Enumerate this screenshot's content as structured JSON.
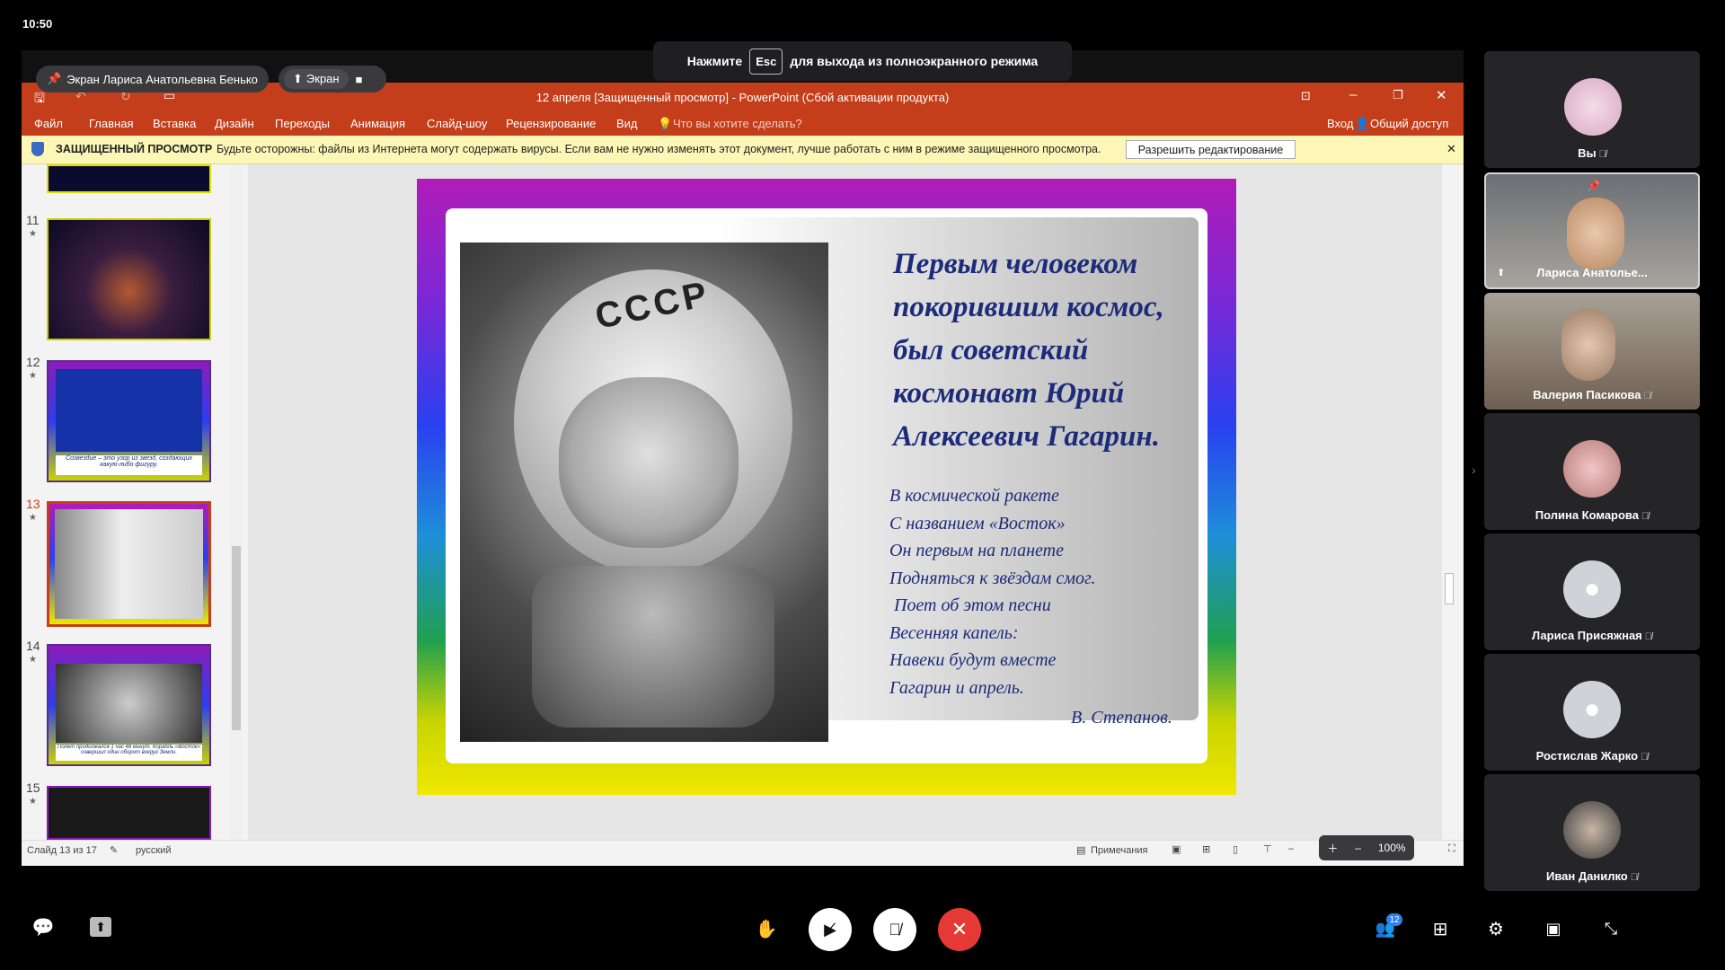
{
  "status": {
    "clock": "10:50"
  },
  "banner": {
    "before": "Нажмите",
    "key": "Esc",
    "after": "для выхода из полноэкранного режима"
  },
  "share": {
    "pinned_label": "Экран Лариса Анатольевна Бенько",
    "screen_label": "Экран"
  },
  "ppt": {
    "title": "12 апреля [Защищенный просмотр] - PowerPoint (Сбой активации продукта)",
    "tabs": [
      "Файл",
      "Главная",
      "Вставка",
      "Дизайн",
      "Переходы",
      "Анимация",
      "Слайд-шоу",
      "Рецензирование",
      "Вид"
    ],
    "tell_me": "Что вы хотите сделать?",
    "signin": "Вход",
    "share": "Общий доступ",
    "protected": {
      "label": "ЗАЩИЩЕННЫЙ ПРОСМОТР",
      "message": "Будьте осторожны: файлы из Интернета могут содержать вирусы. Если вам не нужно изменять этот документ, лучше работать с ним в режиме защищенного просмотра.",
      "button": "Разрешить редактирование"
    },
    "thumbnails": [
      {
        "num": "11",
        "caption": ""
      },
      {
        "num": "12",
        "caption": "Созвездие – это узор из звезд, создающих какую-либо фигуру."
      },
      {
        "num": "13",
        "caption": ""
      },
      {
        "num": "14",
        "caption": "Полет продолжался 1 час 48 минут. Корабль «Восток» совершил один оборот вокруг Земли."
      },
      {
        "num": "15",
        "caption": ""
      }
    ],
    "slide": {
      "helmet_text": "СССР",
      "title_lines": [
        "Первым человеком",
        "покорившим космос,",
        "был советский",
        "космонавт Юрий",
        "Алексеевич Гагарин."
      ],
      "poem_lines": [
        "В космической ракете",
        "С названием «Восток»",
        "Он первым на планете",
        "Подняться к звёздам смог.",
        " Поет об этом песни",
        "Весенняя капель:",
        "Навеки будут вместе",
        "Гагарин и апрель."
      ],
      "author": "В. Степанов."
    },
    "status": {
      "slide": "Слайд 13 из 17",
      "language": "русский",
      "notes": "Примечания",
      "zoom": "100%"
    }
  },
  "participants": [
    {
      "name": "Вы",
      "muted": true
    },
    {
      "name": "Лариса Анатолье...",
      "muted": false
    },
    {
      "name": "Валерия Пасикова",
      "muted": true
    },
    {
      "name": "Полина Комарова",
      "muted": true
    },
    {
      "name": "Лариса Присяжная",
      "muted": true
    },
    {
      "name": "Ростислав Жарко",
      "muted": true
    },
    {
      "name": "Иван Данилко",
      "muted": true
    }
  ],
  "controls": {
    "participants_count": "12"
  },
  "colors": {
    "ppt_accent": "#c43e1c",
    "end_call": "#e53935",
    "slide_text": "#1c2b7a"
  }
}
